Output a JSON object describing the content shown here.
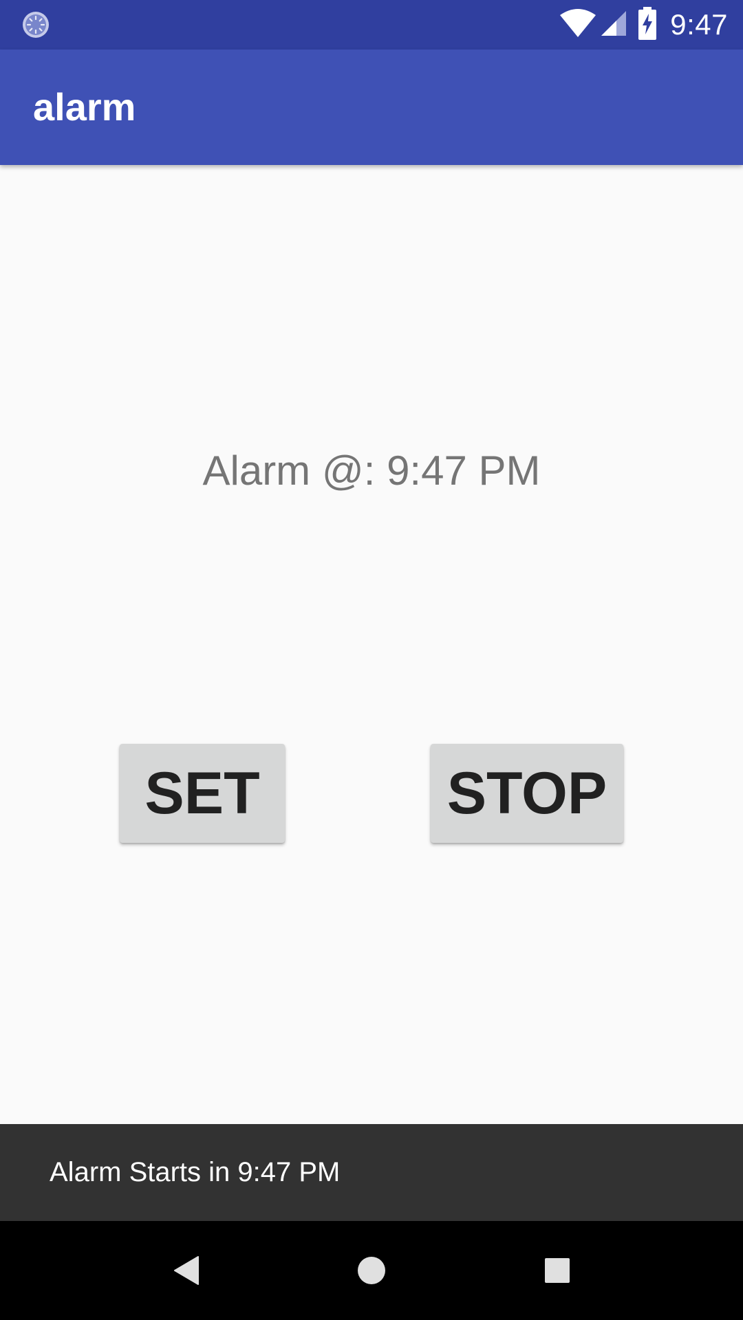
{
  "status_bar": {
    "time": "9:47",
    "icons": [
      "sync-icon",
      "wifi-icon",
      "signal-icon",
      "battery-charging-icon"
    ]
  },
  "app_bar": {
    "title": "alarm"
  },
  "main": {
    "alarm_label": "Alarm @: 9:47 PM",
    "set_button_label": "SET",
    "stop_button_label": "STOP"
  },
  "snackbar": {
    "message": "Alarm Starts in 9:47 PM"
  },
  "nav_bar": {
    "icons": [
      "back-icon",
      "home-icon",
      "recents-icon"
    ]
  },
  "colors": {
    "status_bar": "#303f9f",
    "app_bar": "#3f51b5",
    "background": "#fafafa",
    "button": "#d6d7d7",
    "snackbar": "#323232",
    "nav_bar": "#000000"
  }
}
